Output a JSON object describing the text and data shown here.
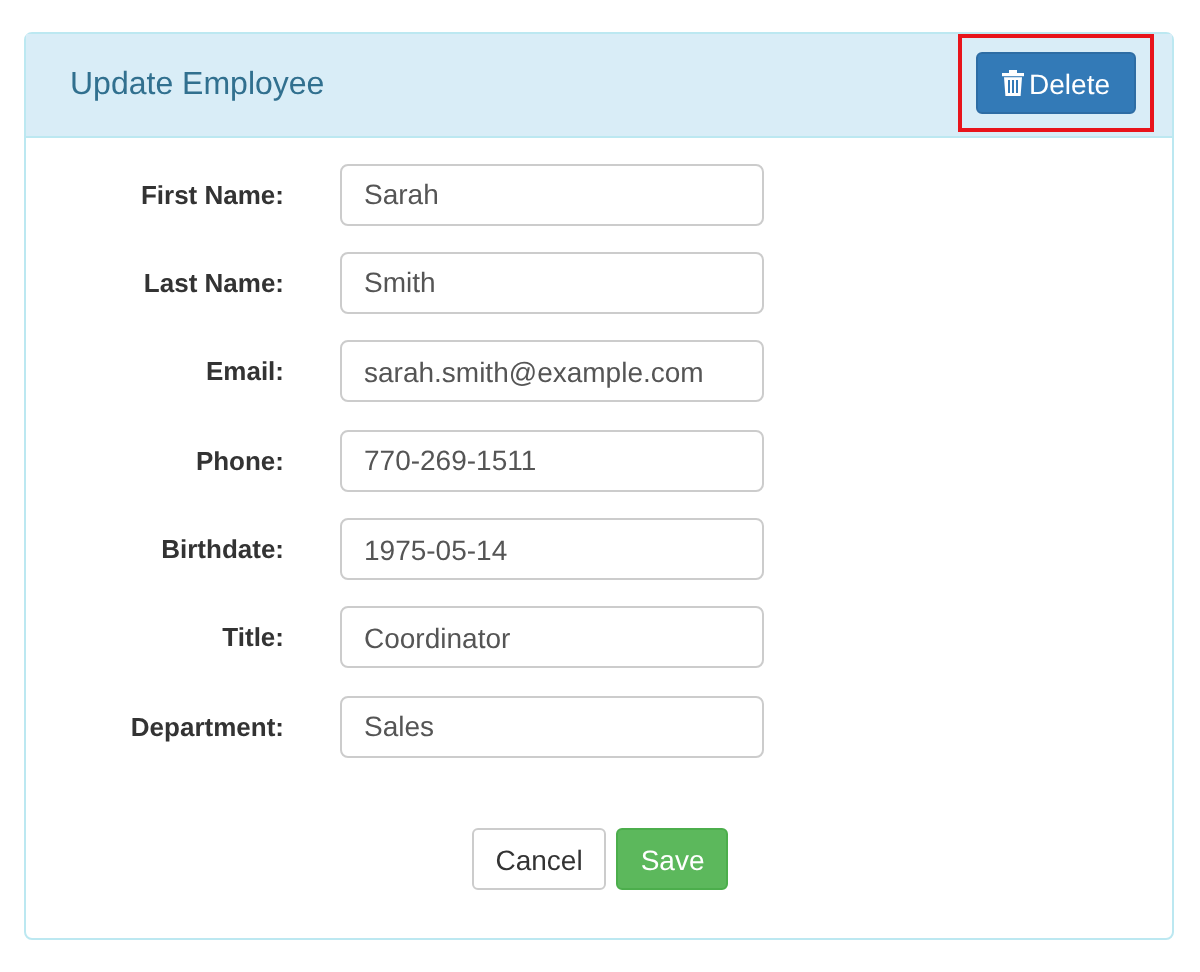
{
  "panel": {
    "title": "Update Employee",
    "delete_button": {
      "label": "Delete",
      "highlighted": true
    }
  },
  "fields": [
    {
      "label": "First Name:",
      "value": "Sarah"
    },
    {
      "label": "Last Name:",
      "value": "Smith"
    },
    {
      "label": "Email:",
      "value": "sarah.smith@example.com"
    },
    {
      "label": "Phone:",
      "value": "770-269-1511"
    },
    {
      "label": "Birthdate:",
      "value": "1975-05-14"
    },
    {
      "label": "Title:",
      "value": "Coordinator"
    },
    {
      "label": "Department:",
      "value": "Sales"
    }
  ],
  "buttons": [
    {
      "label": "Cancel",
      "kind": "default"
    },
    {
      "label": "Save",
      "kind": "primary"
    }
  ]
}
